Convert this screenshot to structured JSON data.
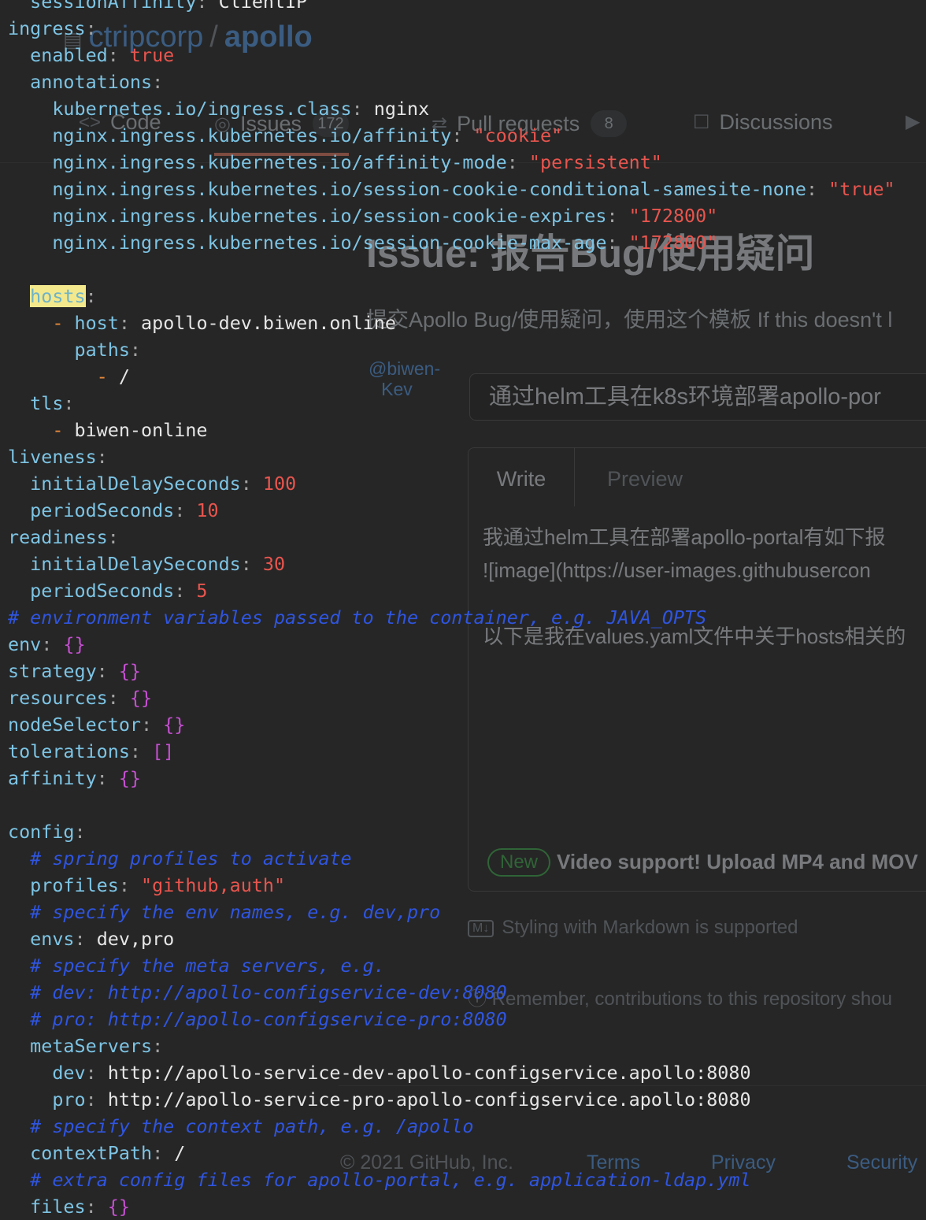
{
  "github": {
    "repo_owner": "ctripcorp",
    "repo_name": "apollo",
    "tabs": [
      {
        "label": "Code",
        "count": ""
      },
      {
        "label": "Issues",
        "count": "172"
      },
      {
        "label": "Pull requests",
        "count": "8"
      },
      {
        "label": "Discussions",
        "count": ""
      }
    ],
    "issue_heading": "Issue: 报告Bug/使用疑问",
    "issue_subtitle": "提交Apollo Bug/使用疑问，使用这个模板 If this doesn't l",
    "avatar_alt": "@biwen-Kev",
    "title_value": "通过helm工具在k8s环境部署apollo-por",
    "editor_tabs": {
      "write": "Write",
      "preview": "Preview"
    },
    "body_lines": [
      "我通过helm工具在部署apollo-portal有如下报",
      "![image](https://user-images.githubusercon",
      "",
      "以下是我在values.yaml文件中关于hosts相关的"
    ],
    "new_badge": "New",
    "video_support": "Video support! Upload MP4 and MOV",
    "markdown_note": "Styling with Markdown is supported",
    "remember_note": "Remember, contributions to this repository shou",
    "footer": {
      "copyright": "© 2021 GitHub, Inc.",
      "links": [
        "Terms",
        "Privacy",
        "Security"
      ]
    }
  },
  "code": {
    "l00": {
      "key": "sessionAffinity",
      "val": "ClientIP"
    },
    "l01": {
      "key": "ingress"
    },
    "l02": {
      "key": "enabled",
      "val": "true"
    },
    "l03": {
      "key": "annotations"
    },
    "l04": {
      "key": "kubernetes.io/ingress.class",
      "val": "nginx"
    },
    "l05": {
      "key": "nginx.ingress.kubernetes.io/affinity",
      "val": "\"cookie\""
    },
    "l06": {
      "key": "nginx.ingress.kubernetes.io/affinity-mode",
      "val": "\"persistent\""
    },
    "l07": {
      "key": "nginx.ingress.kubernetes.io/session-cookie-conditional-samesite-none",
      "val": "\"true\""
    },
    "l08": {
      "key": "nginx.ingress.kubernetes.io/session-cookie-expires",
      "val": "\"172800\""
    },
    "l09": {
      "key": "nginx.ingress.kubernetes.io/session-cookie-max-age",
      "val": "\"172800\""
    },
    "l11": {
      "key": "hosts"
    },
    "l12": {
      "key": "host",
      "val": "apollo-dev.biwen.online"
    },
    "l13": {
      "key": "paths"
    },
    "l14": {
      "val": "/"
    },
    "l15": {
      "key": "tls"
    },
    "l16": {
      "val": "biwen-online"
    },
    "l17": {
      "key": "liveness"
    },
    "l18": {
      "key": "initialDelaySeconds",
      "val": "100"
    },
    "l19": {
      "key": "periodSeconds",
      "val": "10"
    },
    "l20": {
      "key": "readiness"
    },
    "l21": {
      "key": "initialDelaySeconds",
      "val": "30"
    },
    "l22": {
      "key": "periodSeconds",
      "val": "5"
    },
    "l23": {
      "comment": "# environment variables passed to the container, e.g. JAVA_OPTS"
    },
    "l24": {
      "key": "env",
      "val": "{}"
    },
    "l25": {
      "key": "strategy",
      "val": "{}"
    },
    "l26": {
      "key": "resources",
      "val": "{}"
    },
    "l27": {
      "key": "nodeSelector",
      "val": "{}"
    },
    "l28": {
      "key": "tolerations",
      "val": "[]"
    },
    "l29": {
      "key": "affinity",
      "val": "{}"
    },
    "l31": {
      "key": "config"
    },
    "l32": {
      "comment": "# spring profiles to activate"
    },
    "l33": {
      "key": "profiles",
      "val": "\"github,auth\""
    },
    "l34": {
      "comment": "# specify the env names, e.g. dev,pro"
    },
    "l35": {
      "key": "envs",
      "val": "dev,pro"
    },
    "l36": {
      "comment": "# specify the meta servers, e.g."
    },
    "l37": {
      "comment": "# dev: http://apollo-configservice-dev:8080"
    },
    "l38": {
      "comment": "# pro: http://apollo-configservice-pro:8080"
    },
    "l39": {
      "key": "metaServers"
    },
    "l40": {
      "key": "dev",
      "val": "http://apollo-service-dev-apollo-configservice.apollo:8080"
    },
    "l41": {
      "key": "pro",
      "val": "http://apollo-service-pro-apollo-configservice.apollo:8080"
    },
    "l42": {
      "comment": "# specify the context path, e.g. /apollo"
    },
    "l43": {
      "key": "contextPath",
      "val": "/"
    },
    "l44": {
      "comment": "# extra config files for apollo-portal, e.g. application-ldap.yml"
    },
    "l45": {
      "key": "files",
      "val": "{}"
    }
  },
  "colors": {
    "background": "#262626",
    "key": "#7dc4e4",
    "string": "#e8554e",
    "comment": "#2f55e0",
    "brace": "#c44fd0",
    "highlight": "#f3e88c"
  }
}
